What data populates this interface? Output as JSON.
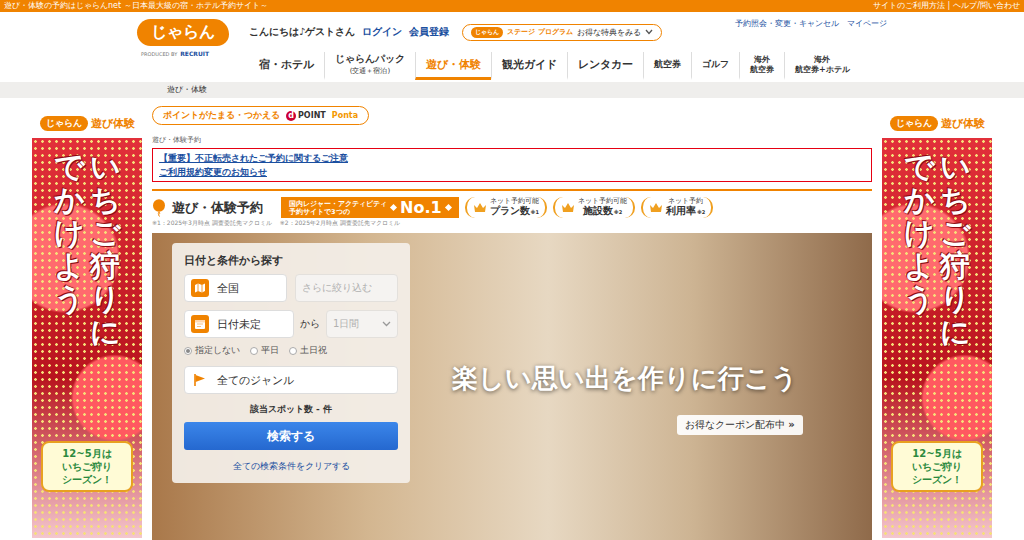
{
  "top_bar": {
    "tagline": "遊び・体験の予約はじゃらんnet ～日本最大級の宿・ホテル予約サイト～",
    "links": [
      "サイトのご利用方法",
      "ヘルプ/問い合わせ"
    ],
    "separator": "|"
  },
  "header": {
    "logo": "じゃらん",
    "logo_credit": "PRODUCED BY",
    "logo_brand": "RECRUIT",
    "greeting": "こんにちは♪ゲストさん",
    "auth_links": [
      "ログイン",
      "会員登録"
    ],
    "stage": {
      "brand": "じゃらん",
      "label": "ステージ プログラム",
      "cta": "お得な特典をみる"
    },
    "account_links": [
      "予約照会・変更・キャンセル",
      "マイページ"
    ]
  },
  "nav": [
    {
      "kind": "single",
      "lines": [
        "宿・ホテル"
      ],
      "selected": false
    },
    {
      "kind": "pack",
      "lines": [
        "じゃらんパック",
        "(交通＋宿泊)"
      ],
      "selected": false
    },
    {
      "kind": "single",
      "lines": [
        "遊び・体験"
      ],
      "selected": true
    },
    {
      "kind": "single",
      "lines": [
        "観光ガイド"
      ],
      "selected": false
    },
    {
      "kind": "single",
      "lines": [
        "レンタカー"
      ],
      "selected": false
    },
    {
      "kind": "small",
      "lines": [
        "航空券"
      ],
      "selected": false
    },
    {
      "kind": "small",
      "lines": [
        "ゴルフ"
      ],
      "selected": false
    },
    {
      "kind": "stacked",
      "lines": [
        "海外",
        "航空券"
      ],
      "selected": false
    },
    {
      "kind": "stacked",
      "lines": [
        "海外",
        "航空券+ホテル"
      ],
      "selected": false
    }
  ],
  "breadcrumb": [
    "遊び・体験"
  ],
  "side_banners": [
    {
      "side": "left",
      "logo": "じゃらん",
      "logo_text": "遊び体験",
      "columns": [
        "いちご狩りに",
        "でかけよう"
      ],
      "bubble": [
        "12~5月は",
        "いちご狩り",
        "シーズン！"
      ]
    },
    {
      "side": "right",
      "logo": "じゃらん",
      "logo_text": "遊び体験",
      "columns": [
        "いちご狩りに",
        "でかけよう"
      ],
      "bubble": [
        "12~5月は",
        "いちご狩り",
        "シーズン！"
      ]
    }
  ],
  "points": {
    "label": "ポイントがたまる・つかえる",
    "brands": [
      {
        "mark": "d",
        "name": "POINT",
        "color": "#cc0033"
      },
      {
        "name": "Ponta",
        "color": "#f39800"
      }
    ]
  },
  "section_label": "遊び・体験予約",
  "notices": [
    "【重要】不正転売されたご予約に関するご注意",
    "ご利用規約変更のお知らせ"
  ],
  "title": "遊び・体験予約",
  "no1": {
    "prefix_lines": [
      "国内レジャー・アクティビティ",
      "予約サイトで3つの"
    ],
    "badge": "No.1",
    "awards": [
      {
        "top": "ネット予約可能",
        "main": "プラン数",
        "note": "※1"
      },
      {
        "top": "ネット予約可能",
        "main": "施設数",
        "note": "※2"
      },
      {
        "top": "ネット予約",
        "main": "利用率",
        "note": "※2"
      }
    ],
    "footnotes": [
      "※1：2025年3月時点 調査委託先マクロミル",
      "※2：2025年2月時点 調査委託先マクロミル"
    ]
  },
  "hero": {
    "caption": "楽しい思い出を作りに行こう",
    "coupon": "お得なクーポン配布中",
    "coupon_arrow": "»"
  },
  "search": {
    "title": "日付と条件から探す",
    "area": "全国",
    "refine_placeholder": "さらに絞り込む",
    "refine_disabled": true,
    "date": "日付未定",
    "from": "から",
    "duration": "1日間",
    "duration_disabled": true,
    "day_options": [
      {
        "label": "指定しない",
        "selected": true
      },
      {
        "label": "平日",
        "selected": false
      },
      {
        "label": "土日祝",
        "selected": false
      }
    ],
    "genre": "全てのジャンル",
    "count_label": "該当スポット数",
    "count": "-",
    "count_unit": "件",
    "submit": "検索する",
    "clear": "全ての検索条件をクリアする"
  }
}
